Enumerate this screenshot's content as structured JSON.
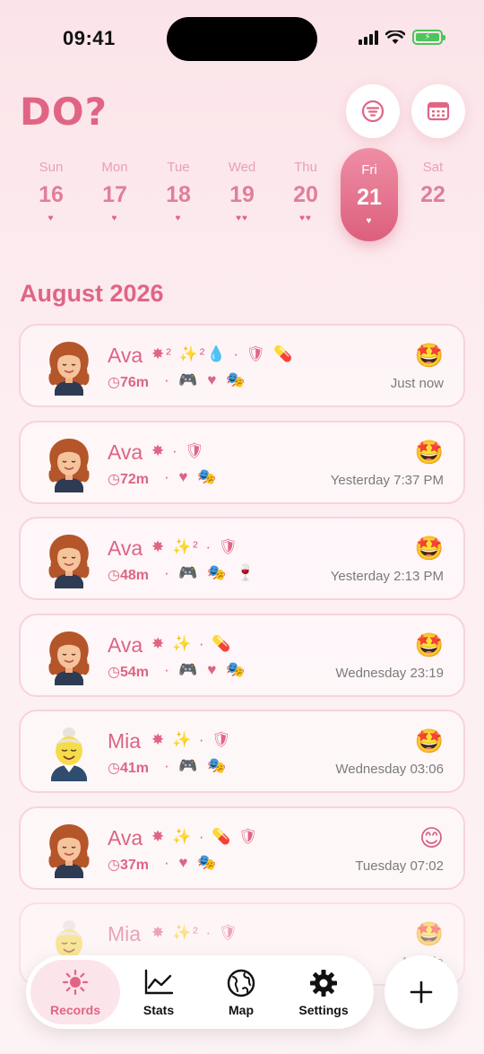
{
  "status": {
    "time": "09:41"
  },
  "header": {
    "title": "DO?",
    "filter_icon": "filter-icon",
    "calendar_icon": "calendar-icon"
  },
  "week": [
    {
      "name": "Sun",
      "num": "16",
      "hearts": "♥"
    },
    {
      "name": "Mon",
      "num": "17",
      "hearts": "♥"
    },
    {
      "name": "Tue",
      "num": "18",
      "hearts": "♥"
    },
    {
      "name": "Wed",
      "num": "19",
      "hearts": "♥♥"
    },
    {
      "name": "Thu",
      "num": "20",
      "hearts": "♥♥"
    },
    {
      "name": "Fri",
      "num": "21",
      "hearts": "♥",
      "selected": true
    },
    {
      "name": "Sat",
      "num": "22",
      "hearts": ""
    }
  ],
  "month": "August 2026",
  "records": [
    {
      "name": "Ava",
      "avatar": "ava",
      "tags": "✸² ✨²💧 · 🛡 💊",
      "duration": "◷76m",
      "activities": "· 🎮 ♥ 🎭",
      "emoji": "🤩",
      "time": "Just now"
    },
    {
      "name": "Ava",
      "avatar": "ava",
      "tags": "✸ · 🛡",
      "duration": "◷72m",
      "activities": "· ♥ 🎭",
      "emoji": "🤩",
      "time": "Yesterday 7:37 PM"
    },
    {
      "name": "Ava",
      "avatar": "ava",
      "tags": "✸ ✨² · 🛡",
      "duration": "◷48m",
      "activities": "· 🎮 🎭 🍷",
      "emoji": "🤩",
      "time": "Yesterday 2:13 PM"
    },
    {
      "name": "Ava",
      "avatar": "ava",
      "tags": "✸ ✨ · 💊",
      "duration": "◷54m",
      "activities": "· 🎮 ♥ 🎭",
      "emoji": "🤩",
      "time": "Wednesday 23:19"
    },
    {
      "name": "Mia",
      "avatar": "mia",
      "tags": "✸ ✨ · 🛡",
      "duration": "◷41m",
      "activities": "· 🎮 🎭",
      "emoji": "🤩",
      "time": "Wednesday 03:06"
    },
    {
      "name": "Ava",
      "avatar": "ava",
      "tags": "✸ ✨ · 💊 🛡",
      "duration": "◷37m",
      "activities": "· ♥ 🎭",
      "emoji": "😊",
      "time": "Tuesday 07:02"
    },
    {
      "name": "Mia",
      "avatar": "mia",
      "tags": "✸ ✨² · 🛡",
      "duration": "",
      "activities": "",
      "emoji": "🤩",
      "time": "Monda"
    }
  ],
  "tabs": [
    {
      "label": "Records",
      "icon": "sun-icon",
      "active": true
    },
    {
      "label": "Stats",
      "icon": "chart-icon"
    },
    {
      "label": "Map",
      "icon": "globe-icon"
    },
    {
      "label": "Settings",
      "icon": "gear-icon"
    }
  ],
  "add_icon": "plus-icon",
  "colors": {
    "accent": "#e06585",
    "selected_day": "#dc5f7e",
    "card_border": "#f7d3dc",
    "battery": "#4cc55b"
  }
}
